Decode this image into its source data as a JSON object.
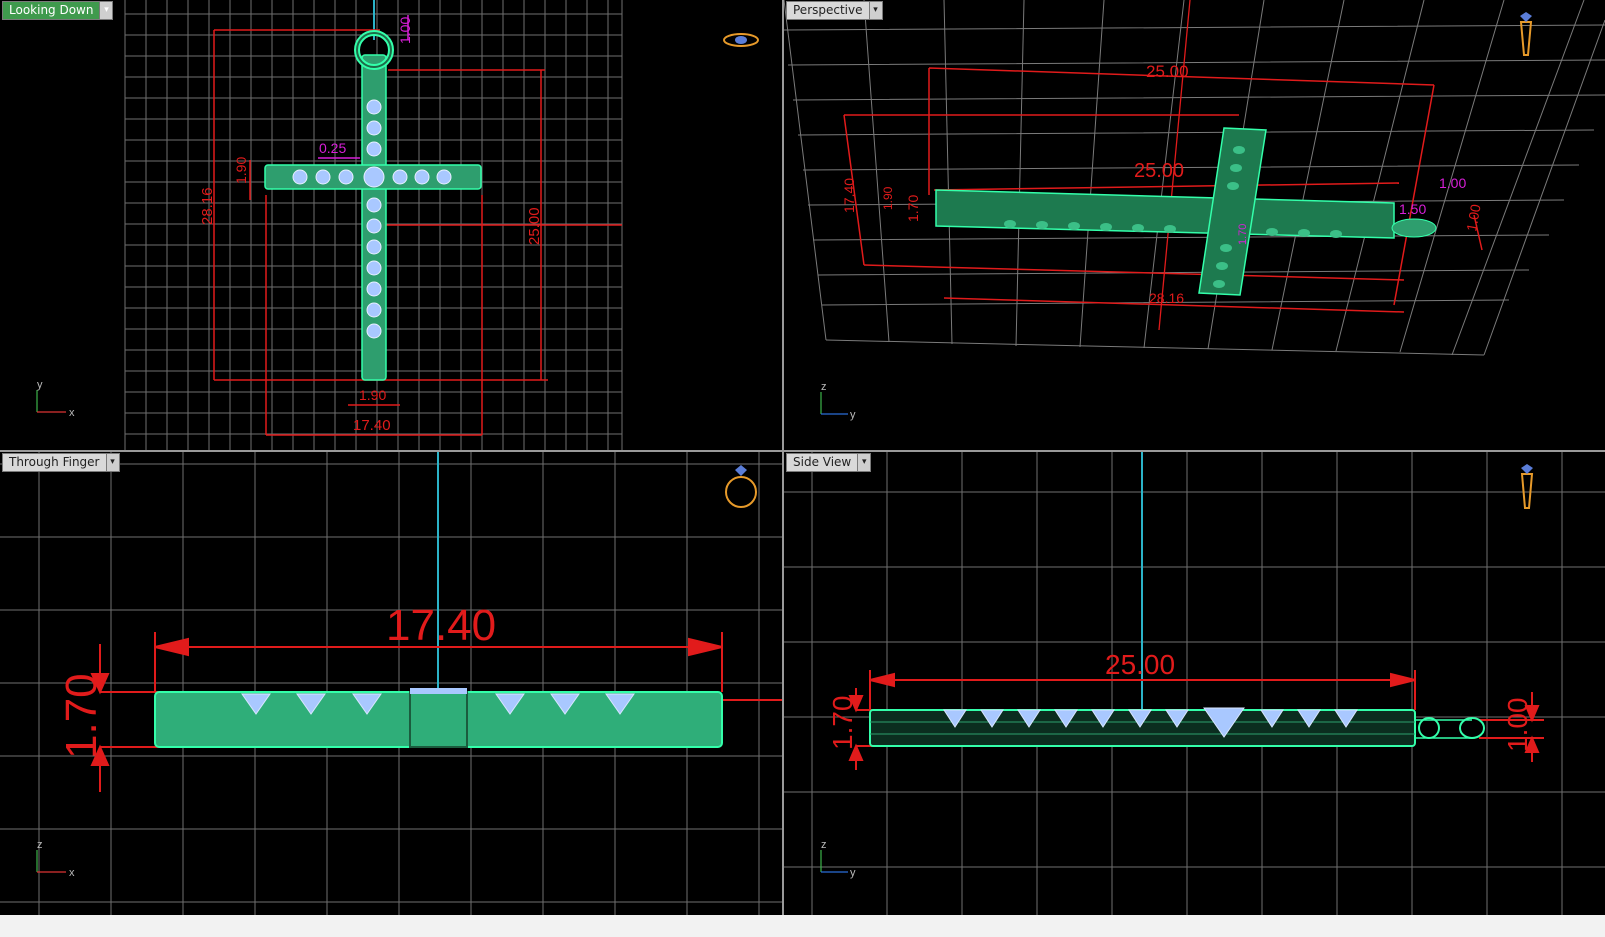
{
  "viewports": {
    "top": {
      "label": "Looking Down",
      "axis_labels": [
        "y",
        "x"
      ],
      "dims": [
        "1.00",
        "0.25",
        "1.90",
        "28.16",
        "25.00",
        "1.90",
        "17.40"
      ]
    },
    "perspective": {
      "label": "Perspective",
      "axis_labels": [
        "z",
        "y"
      ],
      "dims": [
        "25.00",
        "25.00",
        "17.40",
        "1.70",
        "1.90",
        "28.16",
        "1.00",
        "1.50",
        "1.00",
        "1.70"
      ]
    },
    "front": {
      "label": "Through Finger",
      "axis_labels": [
        "z",
        "x"
      ],
      "dims": [
        "17.40",
        "1.70"
      ]
    },
    "side": {
      "label": "Side View",
      "axis_labels": [
        "z",
        "y"
      ],
      "dims": [
        "25.00",
        "1.70",
        "1.00"
      ]
    }
  },
  "colors": {
    "dimension": "#e11b1b",
    "model": "#2e9e6e",
    "model_edge": "#33ffaa",
    "gem": "#a9c8ff",
    "grid": "#6f6f6f",
    "magenta": "#d81fd8",
    "axis": "#2bb3c8"
  },
  "icons": {
    "top": "ring-top-icon",
    "perspective": "ring-perspective-icon",
    "front": "ring-front-icon",
    "side": "ring-side-icon",
    "dropdown": "dropdown-arrow-icon"
  }
}
